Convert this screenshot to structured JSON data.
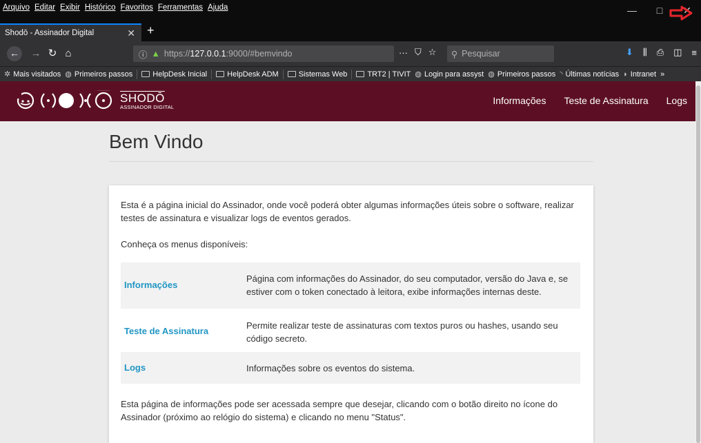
{
  "browser": {
    "menu": [
      "Arquivo",
      "Editar",
      "Exibir",
      "Histórico",
      "Favoritos",
      "Ferramentas",
      "Ajuda"
    ],
    "tab_title": "Shodō - Assinador Digital",
    "url_prefix": "https://",
    "url_host": "127.0.0.1",
    "url_rest": ":9000/#bemvindo",
    "search_placeholder": "Pesquisar",
    "bookmarks": [
      "Mais visitados",
      "Primeiros passos",
      "HelpDesk Inicial",
      "HelpDesk ADM",
      "Sistemas Web",
      "TRT2 | TIVIT",
      "Login para assyst",
      "Primeiros passos",
      "Últimas notícias",
      "Intranet"
    ],
    "accent_color": "#0a84ff"
  },
  "app": {
    "brand_name": "SHODŌ",
    "brand_sub": "ASSINADOR DIGITAL",
    "header_color": "#5c0f24",
    "nav": [
      "Informações",
      "Teste de Assinatura",
      "Logs"
    ]
  },
  "page": {
    "title": "Bem Vindo",
    "intro": "Esta é a página inicial do Assinador, onde você poderá obter algumas informações úteis sobre o software, realizar testes de assinatura e visualizar logs de eventos gerados.",
    "menus_label": "Conheça os menus disponíveis:",
    "menus": [
      {
        "name": "Informações",
        "description": "Página com informações do Assinador, do seu computador, versão do Java e, se estiver com o token conectado à leitora, exibe informações internas deste."
      },
      {
        "name": "Teste de Assinatura",
        "description": "Permite realizar teste de assinaturas com textos puros ou hashes, usando seu código secreto."
      },
      {
        "name": "Logs",
        "description": "Informações sobre os eventos do sistema."
      }
    ],
    "footer_note": "Esta página de informações pode ser acessada sempre que desejar, clicando com o botão direito no ícone do Assinador (próximo ao relógio do sistema) e clicando no menu \"Status\".",
    "link_color": "#2196c4"
  }
}
